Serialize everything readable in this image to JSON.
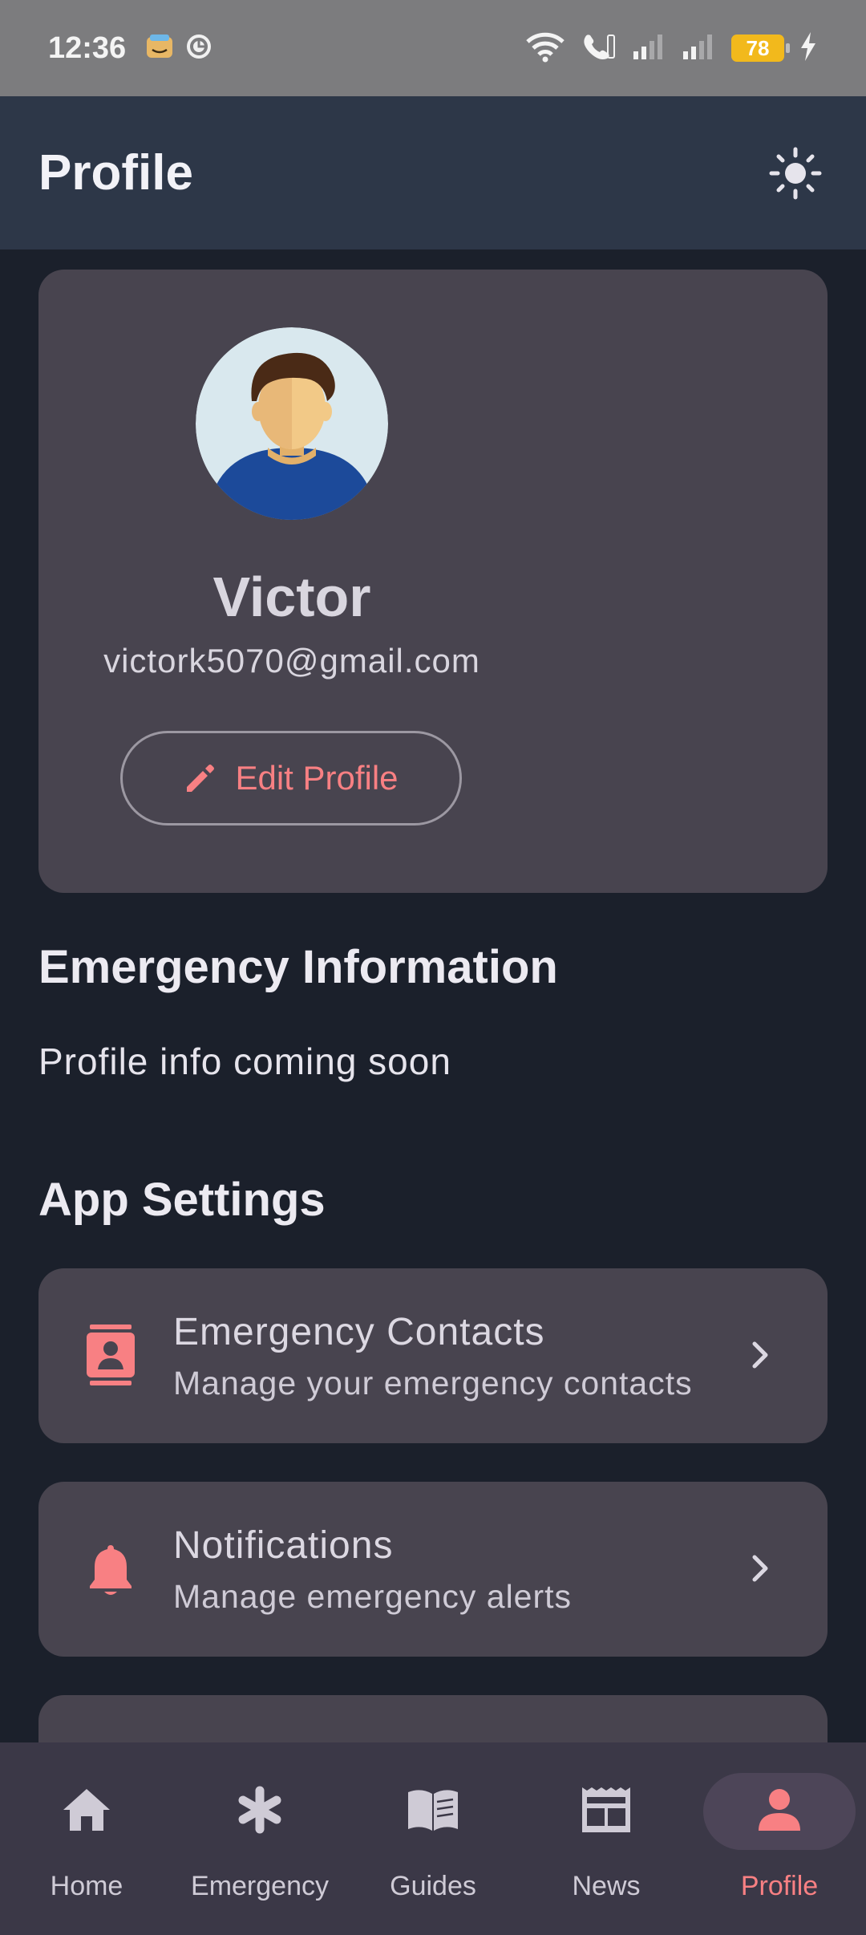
{
  "status_bar": {
    "time": "12:36",
    "battery": "78"
  },
  "app_bar": {
    "title": "Profile"
  },
  "profile": {
    "name": "Victor",
    "email": "victork5070@gmail.com",
    "edit_label": "Edit Profile"
  },
  "emergency_info": {
    "title": "Emergency Information",
    "text": "Profile info coming soon"
  },
  "app_settings": {
    "title": "App Settings",
    "items": [
      {
        "title": "Emergency Contacts",
        "subtitle": "Manage your emergency contacts",
        "icon": "contacts-icon"
      },
      {
        "title": "Notifications",
        "subtitle": "Manage emergency alerts",
        "icon": "bell-icon"
      }
    ]
  },
  "bottom_nav": {
    "items": [
      {
        "label": "Home",
        "icon": "home-icon"
      },
      {
        "label": "Emergency",
        "icon": "asterisk-icon"
      },
      {
        "label": "Guides",
        "icon": "book-icon"
      },
      {
        "label": "News",
        "icon": "newspaper-icon"
      },
      {
        "label": "Profile",
        "icon": "person-icon"
      }
    ],
    "active": "Profile"
  },
  "colors": {
    "accent": "#f88083",
    "background": "#1b202b",
    "appbar": "#2d3748",
    "card": "#48444f"
  }
}
